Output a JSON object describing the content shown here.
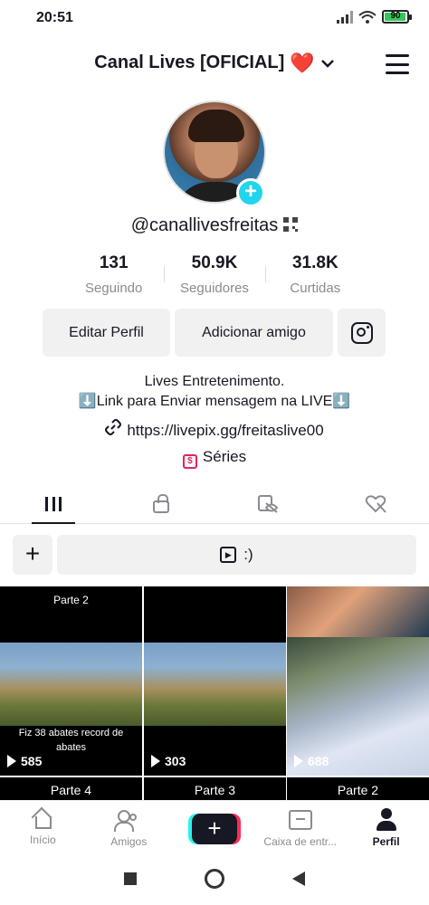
{
  "status_bar": {
    "time": "20:51",
    "battery": "90"
  },
  "header": {
    "title": "Canal Lives [OFICIAL]",
    "heart": "❤️"
  },
  "profile": {
    "username": "@canallivesfreitas",
    "stats": [
      {
        "value": "131",
        "label": "Seguindo"
      },
      {
        "value": "50.9K",
        "label": "Seguidores"
      },
      {
        "value": "31.8K",
        "label": "Curtidas"
      }
    ],
    "buttons": {
      "edit": "Editar Perfil",
      "add_friend": "Adicionar amigo"
    },
    "bio_line1": "Lives Entretenimento.",
    "bio_line2": "⬇️Link para Enviar mensagem na LIVE⬇️",
    "link": "https://livepix.gg/freitaslive00",
    "series": "Séries"
  },
  "playlist": {
    "label": ":)"
  },
  "videos": [
    {
      "caption_top": "Parte 2",
      "caption_mid": "Fiz 38 abates record de abates",
      "views": "585"
    },
    {
      "caption_top": "",
      "caption_mid": "",
      "views": "303"
    },
    {
      "caption_top": "",
      "caption_mid": "",
      "views": "688"
    }
  ],
  "videos_row2": [
    "Parte 4",
    "Parte 3",
    "Parte 2"
  ],
  "bottom_nav": [
    {
      "label": "Início"
    },
    {
      "label": "Amigos"
    },
    {
      "label": ""
    },
    {
      "label": "Caixa de entr..."
    },
    {
      "label": "Perfil"
    }
  ],
  "colors": {
    "accent": "#20d5ec",
    "pink": "#fe2c55",
    "text": "#161823",
    "muted": "#8a8b91"
  }
}
